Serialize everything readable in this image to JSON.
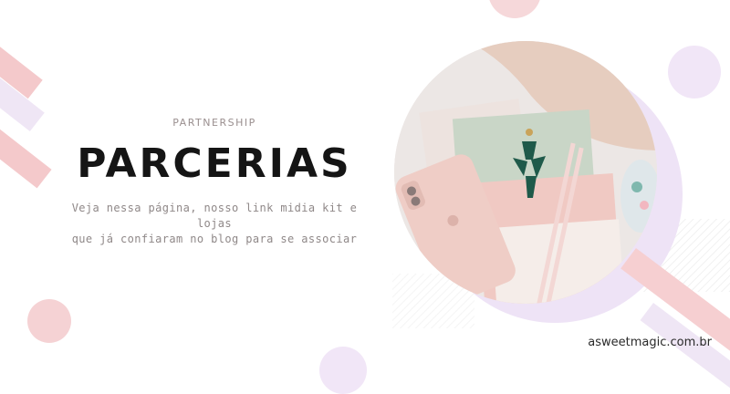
{
  "header": {
    "subtitle": "PARTNERSHIP",
    "title": "PARCERIAS"
  },
  "description": {
    "line1": "Veja nessa página, nosso link midia kit e lojas",
    "line2": "que já confiaram no blog para se associar"
  },
  "footer": {
    "site": "asweetmagic.com.br"
  },
  "colors": {
    "accent_pink": "#f4c9cb",
    "accent_lavender": "#efe6f5",
    "title": "#151515",
    "muted_text": "#8f8888"
  }
}
